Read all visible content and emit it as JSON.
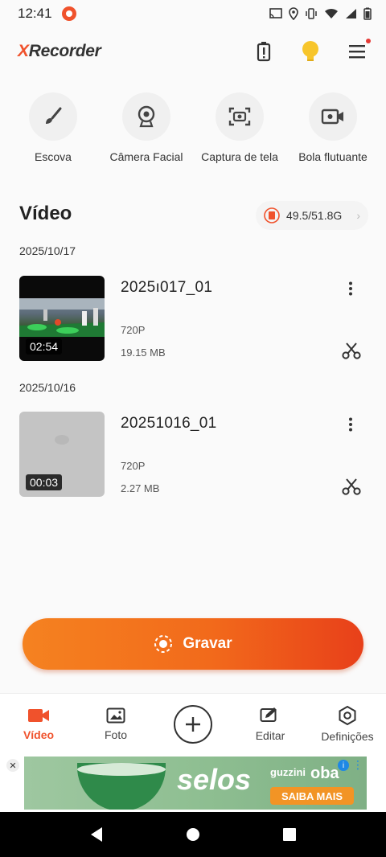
{
  "status_bar": {
    "time": "12:41"
  },
  "header": {
    "logo_x": "X",
    "logo_rest": "Recorder"
  },
  "tools": [
    {
      "label": "Escova",
      "icon": "brush-icon"
    },
    {
      "label": "Câmera Facial",
      "icon": "webcam-icon"
    },
    {
      "label": "Captura de tela",
      "icon": "screenshot-icon"
    },
    {
      "label": "Bola flutuante",
      "icon": "floating-camera-icon"
    }
  ],
  "section": {
    "title": "Vídeo",
    "storage": "49.5/51.8G"
  },
  "groups": [
    {
      "date": "2025/10/17",
      "video": {
        "title": "2025ı017_01",
        "resolution": "720P",
        "size": "19.15 MB",
        "duration": "02:54"
      }
    },
    {
      "date": "2025/10/16",
      "video": {
        "title": "20251016_01",
        "resolution": "720P",
        "size": "2.27 MB",
        "duration": "00:03"
      }
    }
  ],
  "record_button": {
    "label": "Gravar"
  },
  "bottom_nav": [
    {
      "label": "Vídeo",
      "icon": "video-camera-icon",
      "active": true
    },
    {
      "label": "Foto",
      "icon": "photo-icon",
      "active": false
    },
    {
      "label": "",
      "icon": "add-circle-icon",
      "active": false
    },
    {
      "label": "Editar",
      "icon": "edit-icon",
      "active": false
    },
    {
      "label": "Definições",
      "icon": "settings-icon",
      "active": false
    }
  ],
  "ad": {
    "close": "✕",
    "brand": "selos",
    "sponsor_left": "guzzini",
    "sponsor_right": "oba",
    "cta": "SAIBA MAIS",
    "info": "i",
    "more": "⋮"
  },
  "colors": {
    "accent": "#f0522c",
    "record_start": "#f58220",
    "record_end": "#e8401a",
    "bulb": "#f7c52b"
  }
}
